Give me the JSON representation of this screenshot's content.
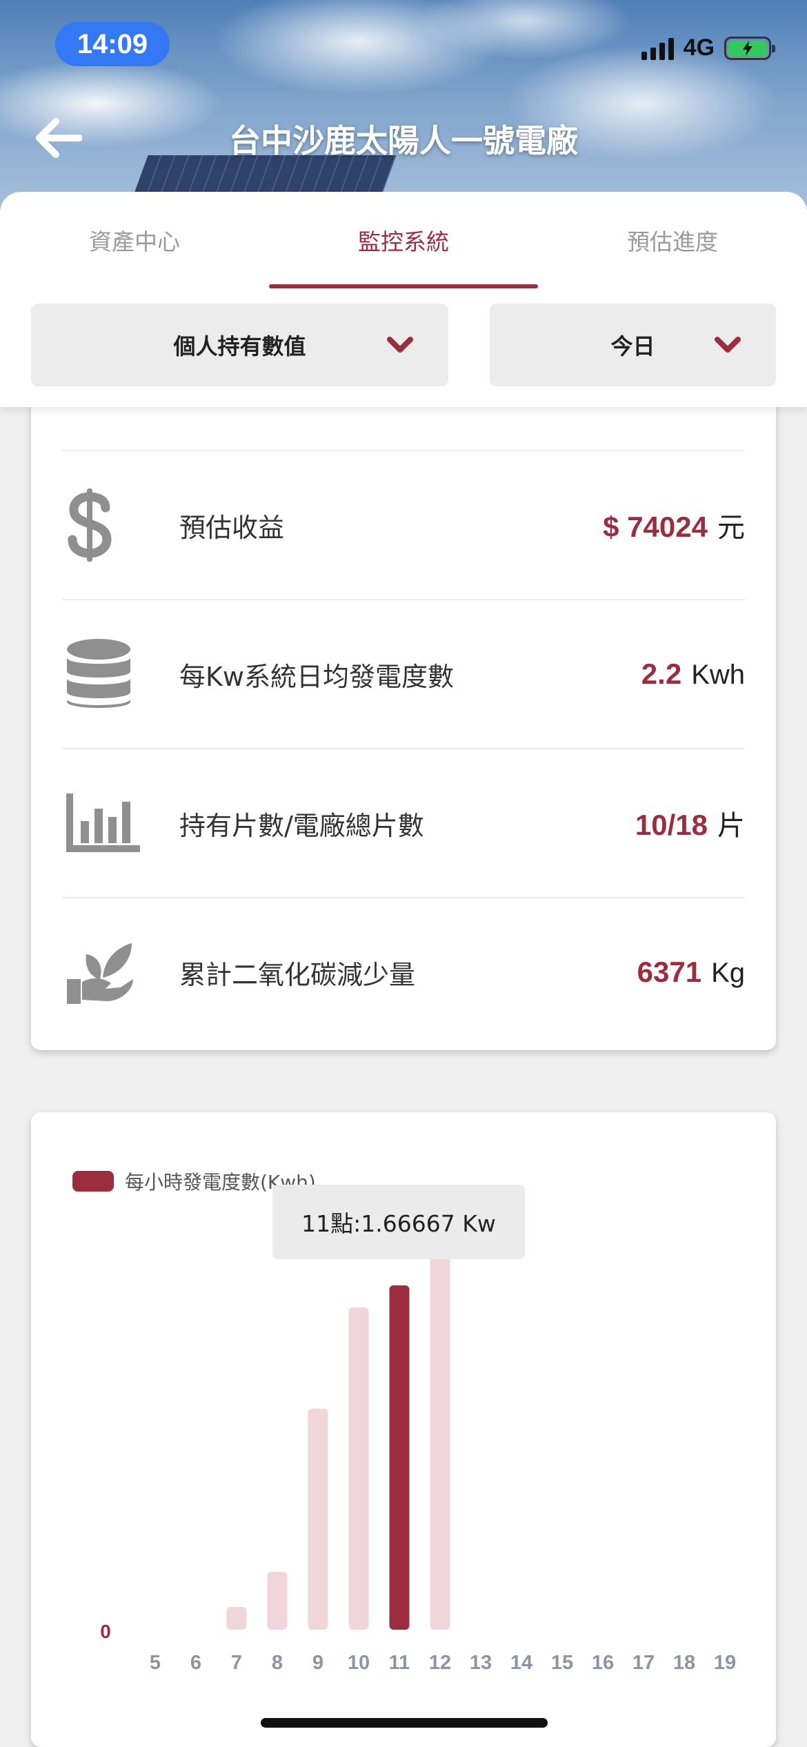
{
  "status_bar": {
    "time": "14:09",
    "network": "4G"
  },
  "header": {
    "title": "台中沙鹿太陽人一號電廠"
  },
  "tabs": [
    {
      "label": "資產中心",
      "active": false
    },
    {
      "label": "監控系統",
      "active": true
    },
    {
      "label": "預估進度",
      "active": false
    }
  ],
  "filters": {
    "data_type": {
      "selected": "個人持有數值"
    },
    "period": {
      "selected": "今日"
    }
  },
  "stats": [
    {
      "icon": "dollar-icon",
      "label": "預估收益",
      "value": "$ 74024",
      "unit": "元"
    },
    {
      "icon": "database-icon",
      "label": "每Kw系統日均發電度數",
      "value": "2.2",
      "unit": "Kwh"
    },
    {
      "icon": "bar-chart-icon",
      "label": "持有片數/電廠總片數",
      "value": "10/18",
      "unit": "片"
    },
    {
      "icon": "plant-hand-icon",
      "label": "累計二氧化碳減少量",
      "value": "6371",
      "unit": "Kg"
    }
  ],
  "colors": {
    "accent": "#9b2d3f",
    "bar_faded": "#f0d6da",
    "tab_inactive": "#9a9a9a"
  },
  "chart_data": {
    "type": "bar",
    "legend": "每小時發電度數(Kwh)",
    "categories": [
      "5",
      "6",
      "7",
      "8",
      "9",
      "10",
      "11",
      "12",
      "13",
      "14",
      "15",
      "16",
      "17",
      "18",
      "19"
    ],
    "series": [
      {
        "name": "每小時發電度數(Kwh)",
        "values": [
          0,
          0,
          0.11,
          0.28,
          1.07,
          1.56,
          1.66667,
          1.82,
          0,
          0,
          0,
          0,
          0,
          0,
          0
        ]
      }
    ],
    "highlighted_category": "11",
    "tooltip": "11點:1.66667 Kw",
    "y_tick_label": "0",
    "ylim": [
      0,
      1.82
    ]
  }
}
